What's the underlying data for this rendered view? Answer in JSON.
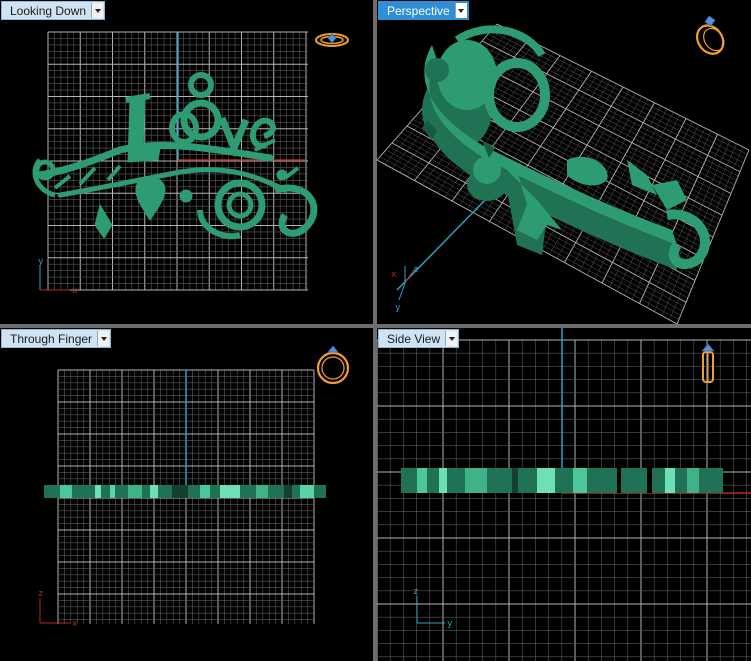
{
  "viewports": {
    "top_left": {
      "label": "Looking Down"
    },
    "top_right": {
      "label": "Perspective"
    },
    "bottom_left": {
      "label": "Through Finger"
    },
    "bottom_right": {
      "label": "Side View"
    }
  },
  "model": {
    "text": "Love"
  },
  "axes": {
    "x": "x",
    "y": "y",
    "z": "z"
  },
  "colors": {
    "model": "#2e9c72",
    "model_dark": "#1f7253",
    "grid": "#8a8a8a",
    "grid_minor": "#4a4a4a",
    "axis_blue": "#2aa0c9",
    "axis_red": "#b82a1a",
    "accent": "#2f8fd6",
    "ring_icon": "#f0a030"
  },
  "icons": [
    "ring-top-icon",
    "ring-perspective-icon",
    "ring-front-icon",
    "ring-side-icon",
    "viewport-dropdown-icon"
  ]
}
